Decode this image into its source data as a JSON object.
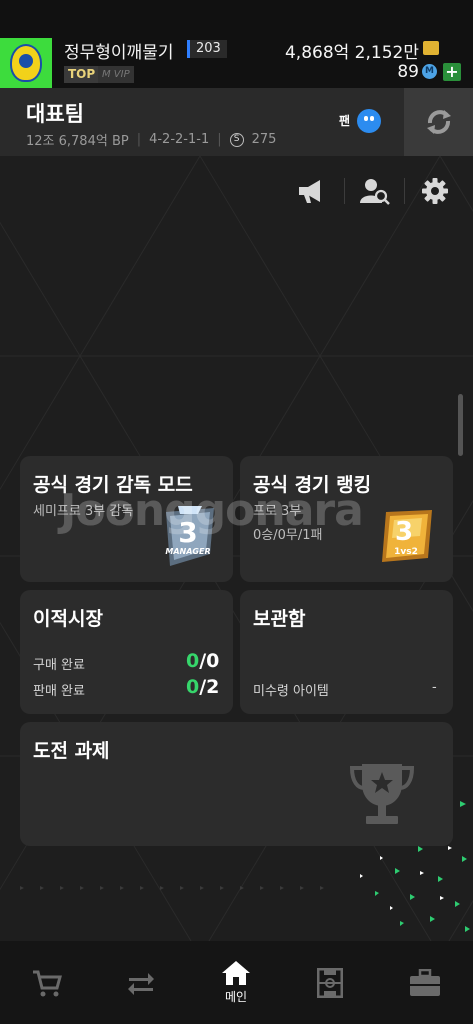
{
  "header": {
    "user_name": "정무형이깨물기",
    "level": "203",
    "top_badge": "TOP",
    "vip_badge": "M VIP",
    "bp_amount": "4,868억 2,152만",
    "mc_amount": "89",
    "mc_icon_letter": "M",
    "plus_label": "+"
  },
  "team": {
    "title": "대표팀",
    "value": "12조 6,784억 BP",
    "formation": "4-2-2-1-1",
    "salary_icon_letter": "S",
    "salary": "275",
    "fan_label": "팬"
  },
  "cards": {
    "manager_mode": {
      "title": "공식 경기 감독 모드",
      "sub": "세미프로 3부 감독",
      "badge_text": "MANAGER",
      "badge_num": "3"
    },
    "ranking": {
      "title": "공식 경기 랭킹",
      "sub": "프로 3부",
      "record": "0승/0무/1패",
      "badge_num": "3",
      "badge_text": "1vs2"
    },
    "transfer": {
      "title": "이적시장",
      "buy_label": "구매 완료",
      "buy_done": "0",
      "buy_total": "/0",
      "sell_label": "판매 완료",
      "sell_done": "0",
      "sell_total": "/2"
    },
    "storage": {
      "title": "보관함",
      "unclaimed_label": "미수령 아이템",
      "unclaimed_value": "-"
    },
    "challenge": {
      "title": "도전 과제"
    }
  },
  "watermark": "Joonggonara",
  "nav": {
    "home_label": "메인",
    "active": "home"
  },
  "colors": {
    "accent_green": "#36d66b",
    "crest_green": "#3ddc3d",
    "fan_blue": "#2c8cf0",
    "gold": "#e0b232"
  }
}
